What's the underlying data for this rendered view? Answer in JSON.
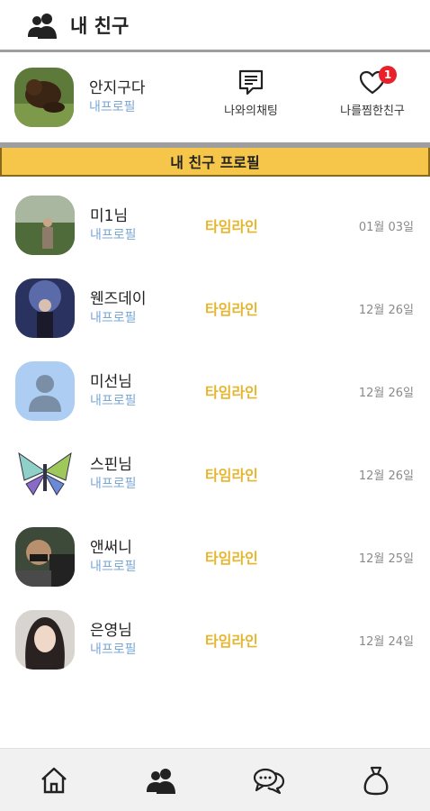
{
  "header": {
    "title": "내 친구",
    "icon": "friends-icon"
  },
  "me": {
    "name": "안지구다",
    "sub": "내프로필"
  },
  "actions": {
    "chat": {
      "label": "나와의채팅",
      "icon": "chat-bubble-icon"
    },
    "likes": {
      "label": "나를찜한친구",
      "icon": "heart-icon",
      "badge": "1"
    }
  },
  "section": {
    "title": "내 친구 프로필"
  },
  "friends": [
    {
      "name": "미1님",
      "sub": "내프로필",
      "timeline": "타임라인",
      "date": "01월 03일"
    },
    {
      "name": "웬즈데이",
      "sub": "내프로필",
      "timeline": "타임라인",
      "date": "12월 26일"
    },
    {
      "name": "미선님",
      "sub": "내프로필",
      "timeline": "타임라인",
      "date": "12월 26일"
    },
    {
      "name": "스핀님",
      "sub": "내프로필",
      "timeline": "타임라인",
      "date": "12월 26일"
    },
    {
      "name": "앤써니",
      "sub": "내프로필",
      "timeline": "타임라인",
      "date": "12월 25일"
    },
    {
      "name": "은영님",
      "sub": "내프로필",
      "timeline": "타임라인",
      "date": "12월 24일"
    }
  ],
  "nav": [
    "home-icon",
    "friends-icon",
    "chat-icon",
    "money-bag-icon"
  ],
  "colors": {
    "accent": "#f6c64a",
    "timeline": "#e6b52e",
    "sub": "#7aa7d6",
    "badge": "#e8212a"
  }
}
